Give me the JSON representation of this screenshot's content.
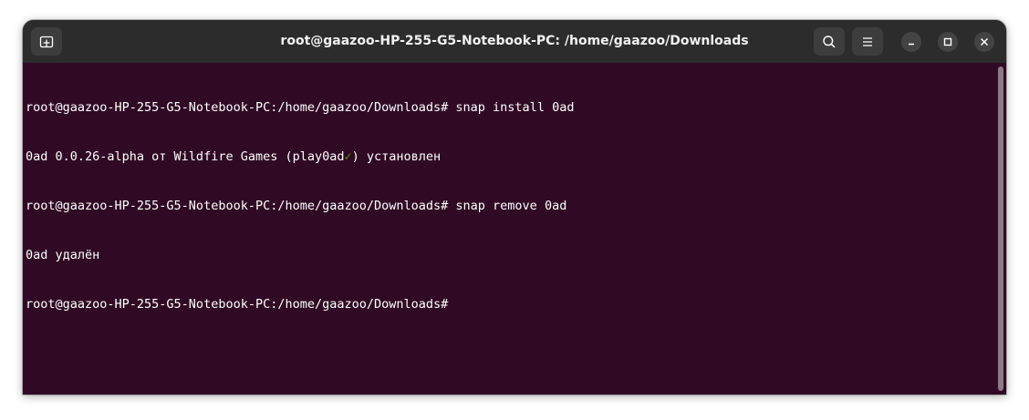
{
  "window": {
    "title": "root@gaazoo-HP-255-G5-Notebook-PC: /home/gaazoo/Downloads"
  },
  "header": {
    "new_tab_icon": "new-tab-icon",
    "search_icon": "search-icon",
    "menu_icon": "hamburger-menu-icon",
    "minimize_icon": "minimize-icon",
    "maximize_icon": "maximize-icon",
    "close_icon": "close-icon"
  },
  "terminal": {
    "lines": [
      {
        "prompt": "root@gaazoo-HP-255-G5-Notebook-PC:/home/gaazoo/Downloads#",
        "command": " snap install 0ad"
      },
      {
        "before_check": "0ad 0.0.26-alpha от Wildfire Games (play0ad",
        "check": "✓",
        "after_check": ") установлен"
      },
      {
        "prompt": "root@gaazoo-HP-255-G5-Notebook-PC:/home/gaazoo/Downloads#",
        "command": " snap remove 0ad"
      },
      {
        "text": "0ad удалён"
      },
      {
        "prompt": "root@gaazoo-HP-255-G5-Notebook-PC:/home/gaazoo/Downloads#"
      }
    ]
  },
  "colors": {
    "terminal_background": "#300a24",
    "headerbar": "#2c2c2c",
    "text": "#ffffff",
    "verified_check": "#4e9a06"
  }
}
